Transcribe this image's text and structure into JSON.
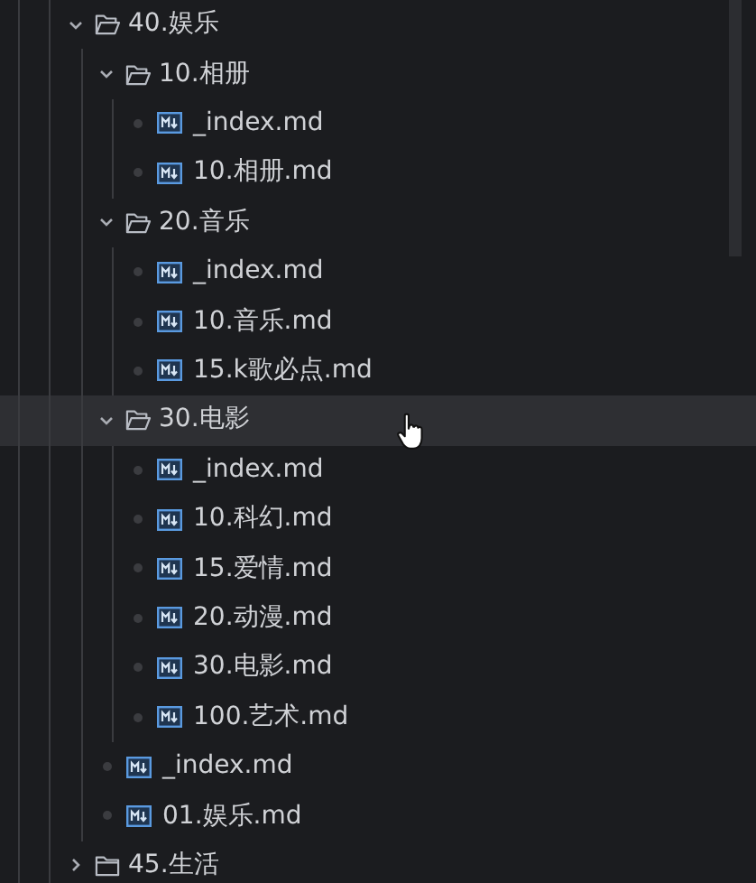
{
  "tree": [
    {
      "name": "40.娱乐",
      "kind": "folder",
      "expanded": true,
      "hovered": false,
      "children": [
        {
          "name": "10.相册",
          "kind": "folder",
          "expanded": true,
          "hovered": false,
          "children": [
            {
              "name": "_index.md",
              "kind": "file",
              "hovered": false
            },
            {
              "name": "10.相册.md",
              "kind": "file",
              "hovered": false
            }
          ]
        },
        {
          "name": "20.音乐",
          "kind": "folder",
          "expanded": true,
          "hovered": false,
          "children": [
            {
              "name": "_index.md",
              "kind": "file",
              "hovered": false
            },
            {
              "name": "10.音乐.md",
              "kind": "file",
              "hovered": false
            },
            {
              "name": "15.k歌必点.md",
              "kind": "file",
              "hovered": false
            }
          ]
        },
        {
          "name": "30.电影",
          "kind": "folder",
          "expanded": true,
          "hovered": true,
          "children": [
            {
              "name": "_index.md",
              "kind": "file",
              "hovered": false
            },
            {
              "name": "10.科幻.md",
              "kind": "file",
              "hovered": false
            },
            {
              "name": "15.爱情.md",
              "kind": "file",
              "hovered": false
            },
            {
              "name": "20.动漫.md",
              "kind": "file",
              "hovered": false
            },
            {
              "name": "30.电影.md",
              "kind": "file",
              "hovered": false
            },
            {
              "name": "100.艺术.md",
              "kind": "file",
              "hovered": false
            }
          ]
        },
        {
          "name": "_index.md",
          "kind": "file",
          "hovered": false
        },
        {
          "name": "01.娱乐.md",
          "kind": "file",
          "hovered": false
        }
      ]
    },
    {
      "name": "45.生活",
      "kind": "folder",
      "expanded": false,
      "hovered": false
    }
  ]
}
